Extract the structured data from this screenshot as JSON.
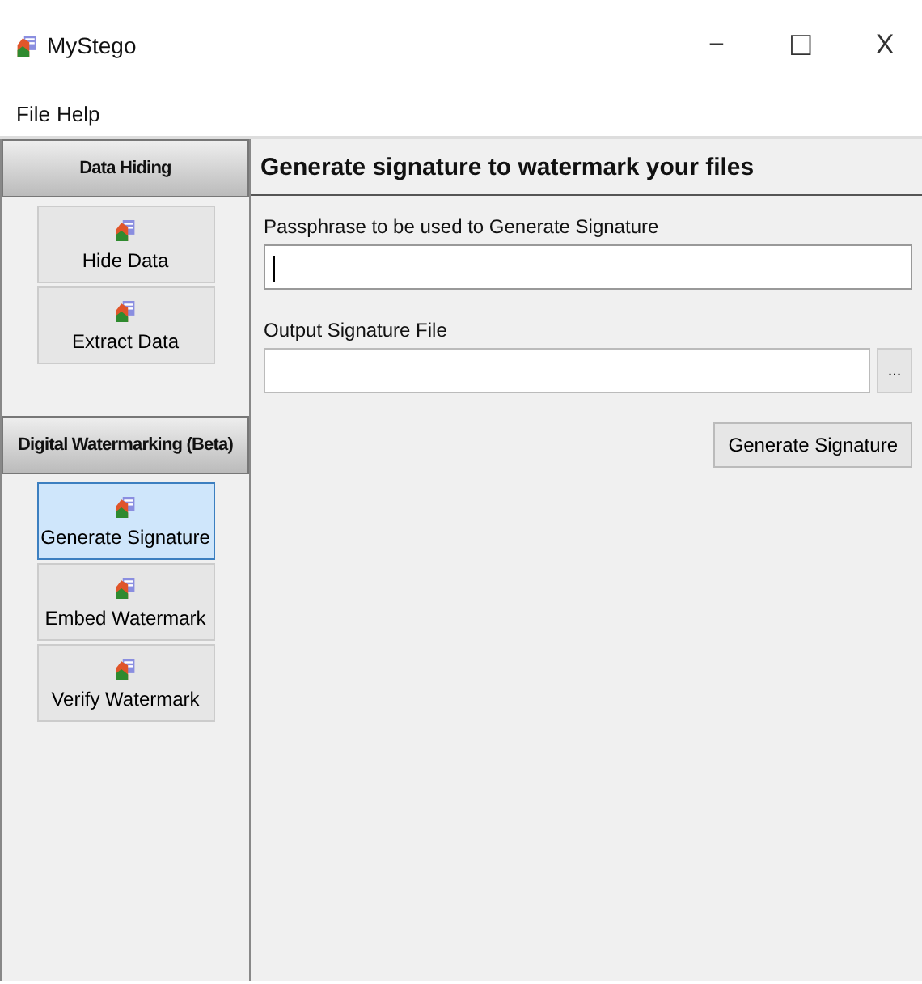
{
  "window": {
    "title": "MyStego",
    "controls": [
      "−",
      "☐",
      "X"
    ]
  },
  "menu": [
    "File",
    "Help"
  ],
  "sidebar": {
    "sections": [
      {
        "title": "Data Hiding",
        "items": [
          {
            "label": "Hide Data",
            "selected": false
          },
          {
            "label": "Extract Data",
            "selected": false
          }
        ]
      },
      {
        "title": "Digital Watermarking (Beta)",
        "items": [
          {
            "label": "Generate Signature",
            "selected": true
          },
          {
            "label": "Embed Watermark",
            "selected": false
          },
          {
            "label": "Verify Watermark",
            "selected": false
          }
        ]
      }
    ]
  },
  "panel": {
    "title": "Generate signature to watermark your files",
    "fields": [
      {
        "label": "Passphrase to be used to Generate Signature",
        "focused": true
      },
      {
        "label": "Output Signature File",
        "focused": false,
        "browse": "..."
      }
    ],
    "button": "Generate Signature"
  }
}
